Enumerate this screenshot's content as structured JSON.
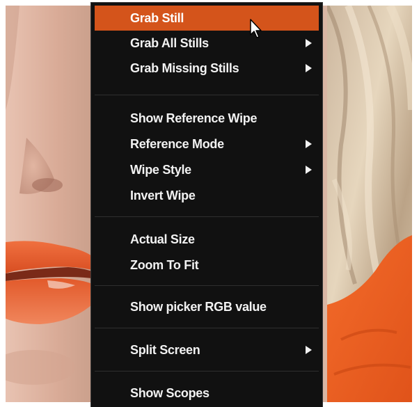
{
  "menu": {
    "items": [
      {
        "label": "Grab Still"
      },
      {
        "label": "Grab All Stills"
      },
      {
        "label": "Grab Missing Stills"
      },
      {
        "label": "Show Reference Wipe"
      },
      {
        "label": "Reference Mode"
      },
      {
        "label": "Wipe Style"
      },
      {
        "label": "Invert Wipe"
      },
      {
        "label": "Actual Size"
      },
      {
        "label": "Zoom To Fit"
      },
      {
        "label": "Show picker RGB value"
      },
      {
        "label": "Split Screen"
      },
      {
        "label": "Show Scopes"
      }
    ]
  },
  "colors": {
    "menu_background": "#111111",
    "highlight": "#d4541b",
    "text": "#f2f2f2"
  },
  "icons": {
    "submenu": "submenu-arrow-icon",
    "pointer": "mouse-pointer-icon"
  }
}
